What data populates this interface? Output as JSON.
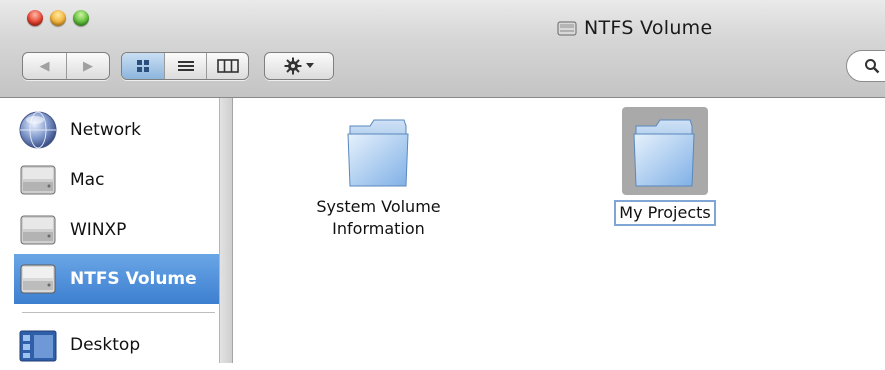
{
  "window": {
    "title": "NTFS Volume"
  },
  "toolbar": {
    "back_icon": "back-arrow-icon",
    "forward_icon": "forward-arrow-icon",
    "view_icons": [
      "icon-view-icon",
      "list-view-icon",
      "column-view-icon"
    ],
    "action_icon": "gear-icon",
    "search_icon": "search-icon"
  },
  "sidebar": {
    "items": [
      {
        "label": "Network",
        "icon": "network-globe-icon"
      },
      {
        "label": "Mac",
        "icon": "hard-drive-icon"
      },
      {
        "label": "WINXP",
        "icon": "hard-drive-icon"
      },
      {
        "label": "NTFS Volume",
        "icon": "hard-drive-icon",
        "selected": true
      },
      {
        "label": "Desktop",
        "icon": "desktop-folder-icon"
      }
    ]
  },
  "files": [
    {
      "name_line1": "System Volume",
      "name_line2": "Information",
      "icon": "folder-icon"
    },
    {
      "name": "My Projects",
      "icon": "folder-icon",
      "selected": true,
      "editing": true
    }
  ],
  "colors": {
    "selection": "#3d7fd0",
    "toolbar": "#d6d6d6"
  }
}
